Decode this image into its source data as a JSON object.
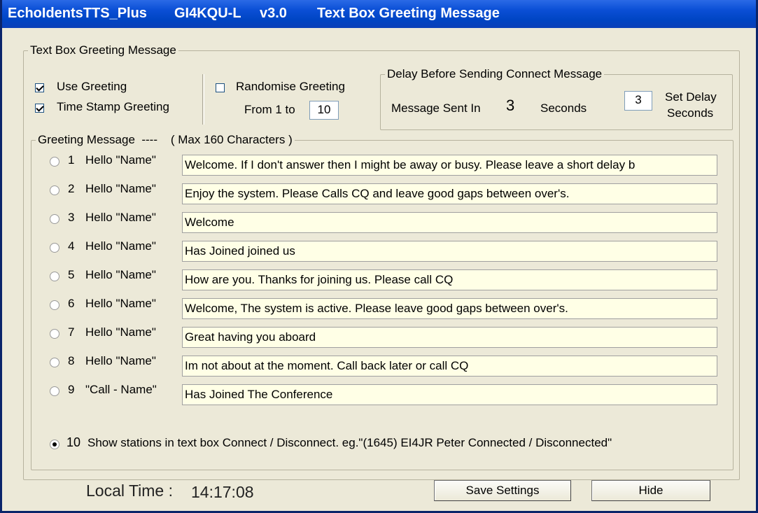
{
  "window": {
    "title_app": "EchoIdentsTTS_Plus",
    "title_call": "GI4KQU-L",
    "title_version": "v3.0",
    "title_screen": "Text Box Greeting Message"
  },
  "group_main": {
    "legend": "Text Box Greeting Message"
  },
  "options": {
    "use_greeting": {
      "label": "Use Greeting",
      "checked": true
    },
    "time_stamp": {
      "label": "Time Stamp Greeting",
      "checked": true
    },
    "randomise": {
      "label": "Randomise  Greeting",
      "checked": false
    },
    "from_label": "From 1 to",
    "from_value": "10"
  },
  "delay": {
    "legend": "Delay Before Sending Connect Message",
    "sent_in_label": "Message Sent In",
    "sent_in_value": "3",
    "seconds_label": "Seconds",
    "set_value": "3",
    "set_label_1": "Set Delay",
    "set_label_2": "Seconds"
  },
  "greetings": {
    "legend": "Greeting Message  ----    ( Max 160 Characters )",
    "items": [
      {
        "num": "1",
        "label": "Hello \"Name\"",
        "text": "Welcome. If I don't answer then I might be away or busy. Please leave a short delay b",
        "selected": false
      },
      {
        "num": "2",
        "label": "Hello \"Name\"",
        "text": "Enjoy the system. Please Calls CQ and leave good gaps between over's.",
        "selected": false
      },
      {
        "num": "3",
        "label": "Hello \"Name\"",
        "text": "Welcome",
        "selected": false
      },
      {
        "num": "4",
        "label": "Hello \"Name\"",
        "text": "Has Joined joined us",
        "selected": false
      },
      {
        "num": "5",
        "label": "Hello \"Name\"",
        "text": "How are you. Thanks for joining us. Please call CQ",
        "selected": false
      },
      {
        "num": "6",
        "label": "Hello \"Name\"",
        "text": "Welcome, The system is active. Please leave good gaps between over's.",
        "selected": false
      },
      {
        "num": "7",
        "label": "Hello \"Name\"",
        "text": "Great having you aboard",
        "selected": false
      },
      {
        "num": "8",
        "label": "Hello \"Name\"",
        "text": "Im not about at the moment. Call back later or call CQ",
        "selected": false
      },
      {
        "num": "9",
        "label": "\"Call - Name\"",
        "text": "Has Joined The Conference",
        "selected": false
      }
    ],
    "item10": {
      "num": "10",
      "label": "Show stations in text box Connect / Disconnect.  eg.\"(1645) EI4JR  Peter Connected / Disconnected\"",
      "selected": true
    }
  },
  "footer": {
    "local_time_label": "Local Time :",
    "local_time_value": "14:17:08",
    "save_button": "Save Settings",
    "hide_button": "Hide"
  }
}
